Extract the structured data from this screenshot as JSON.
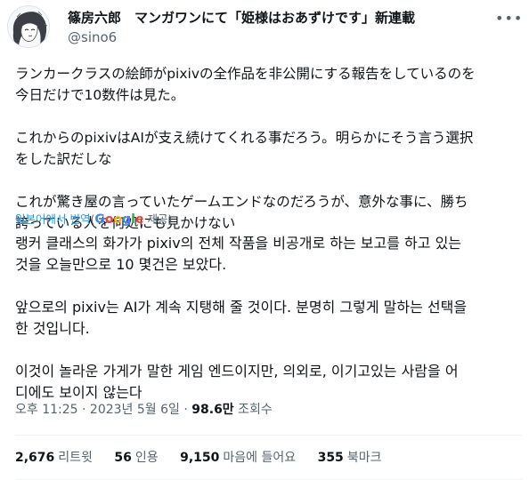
{
  "author": {
    "display_name": "篠房六郎　マンガワンにて「姫様はおあずけです」新連載",
    "handle": "@sino6"
  },
  "more_icon": "more-horizontal-icon",
  "tweet": {
    "lines": [
      "ランカークラスの絵師がpixivの全作品を非公開にする報告をしているのを",
      "今日だけで10数件は見た。",
      "",
      "これからのpixivはAIが支え続けてくれる事だろう。明らかにそう言う選択",
      "をした訳だしな",
      "",
      "これが驚き屋の言っていたゲームエンドなのだろうが、意外な事に、勝ち",
      "誇っている人を何処にも見かけない"
    ]
  },
  "translation": {
    "link_label": "일본어에서 번역",
    "by_prefix": "(",
    "by_brand": "Google",
    "by_suffix": " 제공)",
    "brand_colors": [
      "#4285f4",
      "#ea4335",
      "#fbbc05",
      "#4285f4",
      "#34a853",
      "#ea4335"
    ],
    "lines": [
      "랭커 클래스의 화가가 pixiv의 전체 작품을 비공개로 하는 보고를 하고 있는",
      "것을 오늘만으로 10 몇건은 보았다.",
      "",
      "앞으로의 pixiv는 AI가 계속 지탱해 줄 것이다. 분명히 그렇게 말하는 선택을",
      "한 것입니다.",
      "",
      "이것이 놀라운 가게가 말한 게임 엔드이지만, 의외로, 이기고있는 사람을 어",
      "디에도 보이지 않는다"
    ]
  },
  "meta": {
    "time": "오후 11:25",
    "sep1": " · ",
    "date": "2023년 5월 6일",
    "sep2": " · ",
    "views": "98.6만",
    "views_label": " 조회수"
  },
  "stats": [
    {
      "num": "2,676",
      "label": "리트윗"
    },
    {
      "num": "56",
      "label": "인용"
    },
    {
      "num": "9,150",
      "label": "마음에 들어요"
    },
    {
      "num": "355",
      "label": "북마크"
    }
  ]
}
